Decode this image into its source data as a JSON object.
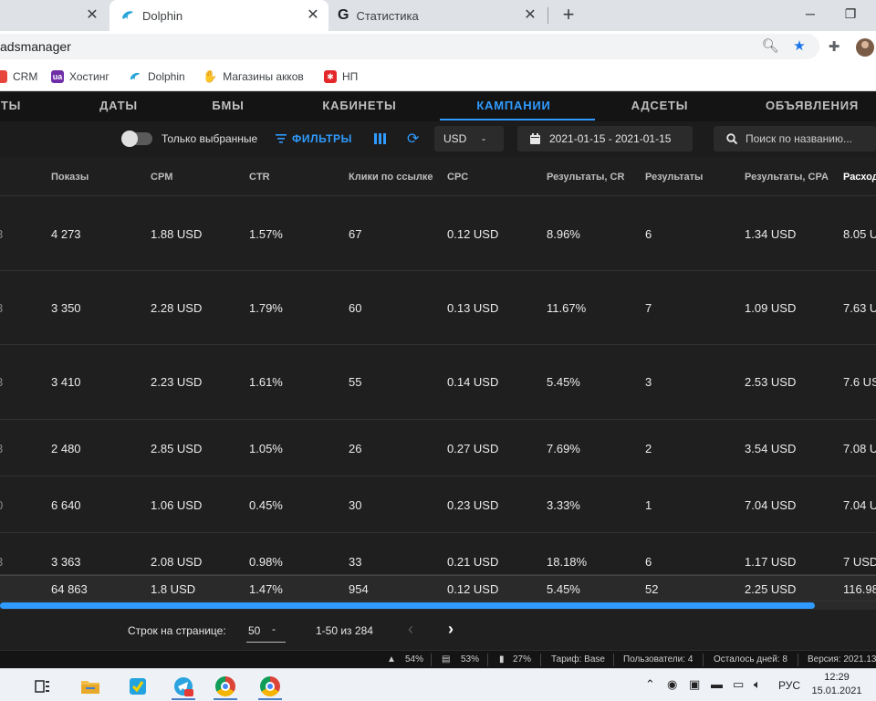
{
  "browser": {
    "tabs": [
      {
        "title": "",
        "active": false
      },
      {
        "title": "Dolphin",
        "active": true,
        "icon": "dolphin-icon"
      },
      {
        "title": "Статистика",
        "active": false,
        "icon": "google-icon"
      }
    ],
    "new_tab_label": "+",
    "address": "adsmanager",
    "bookmarks": [
      {
        "label": "CRM",
        "icon": "crm-icon",
        "color": "#e8453c"
      },
      {
        "label": "Хостинг",
        "icon": "ua-icon",
        "color": "#6f2da8",
        "badge": "ua"
      },
      {
        "label": "Dolphin",
        "icon": "dolphin-icon",
        "color": "#2aa5d8"
      },
      {
        "label": "Магазины акков",
        "icon": "handshake-icon",
        "color": "#8a5a2b"
      },
      {
        "label": "НП",
        "icon": "np-icon",
        "color": "#e4272b"
      }
    ]
  },
  "nav": {
    "items": [
      "ТЫ",
      "ДАТЫ",
      "БМЫ",
      "КАБИНЕТЫ",
      "КАМПАНИИ",
      "АДСЕТЫ",
      "ОБЪЯВЛЕНИЯ"
    ],
    "active": "КАМПАНИИ",
    "accent": "#2f9bff"
  },
  "toolbar": {
    "only_selected": "Только выбранные",
    "filters": "ФИЛЬТРЫ",
    "currency": "USD",
    "currency_caret": "-",
    "date_range": "2021-01-15 - 2021-01-15",
    "search_placeholder": "Поиск по названию..."
  },
  "table": {
    "columns": [
      "Показы",
      "CPM",
      "CTR",
      "Клики по ссылке",
      "CPC",
      "Результаты, CR",
      "Результаты",
      "Результаты, CPA",
      "Расход"
    ],
    "rows": [
      {
        "lead": "3",
        "cells": [
          "4 273",
          "1.88 USD",
          "1.57%",
          "67",
          "0.12 USD",
          "8.96%",
          "6",
          "1.34 USD",
          "8.05 U"
        ]
      },
      {
        "lead": "3",
        "cells": [
          "3 350",
          "2.28 USD",
          "1.79%",
          "60",
          "0.13 USD",
          "11.67%",
          "7",
          "1.09 USD",
          "7.63 U"
        ]
      },
      {
        "lead": "3",
        "cells": [
          "3 410",
          "2.23 USD",
          "1.61%",
          "55",
          "0.14 USD",
          "5.45%",
          "3",
          "2.53 USD",
          "7.6 US"
        ]
      },
      {
        "lead": "3",
        "cells": [
          "2 480",
          "2.85 USD",
          "1.05%",
          "26",
          "0.27 USD",
          "7.69%",
          "2",
          "3.54 USD",
          "7.08 U"
        ]
      },
      {
        "lead": "0",
        "cells": [
          "6 640",
          "1.06 USD",
          "0.45%",
          "30",
          "0.23 USD",
          "3.33%",
          "1",
          "7.04 USD",
          "7.04 U"
        ]
      },
      {
        "lead": "3",
        "cells": [
          "3 363",
          "2.08 USD",
          "0.98%",
          "33",
          "0.21 USD",
          "18.18%",
          "6",
          "1.17 USD",
          "7 USD"
        ]
      }
    ],
    "total": [
      "64 863",
      "1.8 USD",
      "1.47%",
      "954",
      "0.12 USD",
      "5.45%",
      "52",
      "2.25 USD",
      "116.98"
    ]
  },
  "scroll_fraction": 0.93,
  "pager": {
    "rows_label": "Строк на странице:",
    "rows_value": "50",
    "rows_caret": "-",
    "range": "1-50 из 284",
    "prev": "‹",
    "next": "›"
  },
  "status": {
    "cpu": "54%",
    "ram": "53%",
    "disk": "27%",
    "tariff": "Тариф: Base",
    "users": "Пользователи: 4",
    "days_left": "Осталось дней: 8",
    "version": "Версия: 2021.13"
  },
  "taskbar": {
    "lang": "РУС",
    "time": "12:29",
    "date": "15.01.2021"
  }
}
